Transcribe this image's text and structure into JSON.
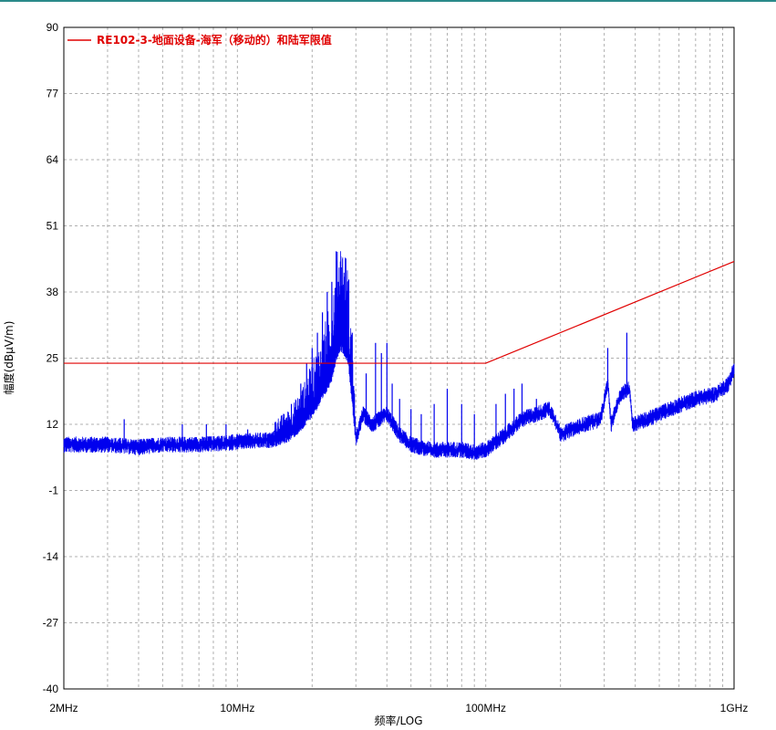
{
  "chart_data": {
    "type": "line",
    "xlabel": "频率/LOG",
    "ylabel": "幅度(dBμV/m)",
    "x_scale": "log",
    "xlim_hz": [
      2000000,
      1000000000
    ],
    "ylim": [
      -40,
      90
    ],
    "x_ticks": [
      {
        "label": "2MHz",
        "value": 2000000
      },
      {
        "label": "10MHz",
        "value": 10000000
      },
      {
        "label": "100MHz",
        "value": 100000000
      },
      {
        "label": "1GHz",
        "value": 1000000000
      }
    ],
    "y_ticks": [
      90,
      77,
      64,
      51,
      38,
      25,
      12,
      -1,
      -14,
      -27,
      -40
    ],
    "grid": true,
    "legend_position": "top-left",
    "colors": {
      "limit": "#e00000",
      "measurement": "#0000ee",
      "grid": "#b0b0b0"
    },
    "series": [
      {
        "name": "RE102-3-地面设备-海军（移动的）和陆军限值",
        "role": "limit",
        "points": [
          [
            2000000,
            24
          ],
          [
            100000000,
            24
          ],
          [
            1000000000,
            44
          ]
        ]
      },
      {
        "name": "",
        "role": "measurement",
        "points": [
          [
            2000000,
            8
          ],
          [
            3000000,
            8
          ],
          [
            4000000,
            7.5
          ],
          [
            5000000,
            8
          ],
          [
            7000000,
            8
          ],
          [
            10000000,
            8.5
          ],
          [
            14000000,
            9
          ],
          [
            16000000,
            10
          ],
          [
            18000000,
            12
          ],
          [
            20000000,
            15
          ],
          [
            22000000,
            18
          ],
          [
            24000000,
            22
          ],
          [
            25000000,
            26
          ],
          [
            26000000,
            28
          ],
          [
            27000000,
            27
          ],
          [
            28000000,
            25
          ],
          [
            30000000,
            9
          ],
          [
            32000000,
            14
          ],
          [
            35000000,
            12
          ],
          [
            40000000,
            14
          ],
          [
            45000000,
            10
          ],
          [
            50000000,
            8
          ],
          [
            60000000,
            7
          ],
          [
            70000000,
            7
          ],
          [
            80000000,
            7
          ],
          [
            90000000,
            6.5
          ],
          [
            100000000,
            7
          ],
          [
            120000000,
            10
          ],
          [
            140000000,
            13
          ],
          [
            160000000,
            14
          ],
          [
            180000000,
            15
          ],
          [
            190000000,
            13
          ],
          [
            200000000,
            10
          ],
          [
            250000000,
            12
          ],
          [
            290000000,
            13
          ],
          [
            310000000,
            20
          ],
          [
            320000000,
            12
          ],
          [
            350000000,
            18
          ],
          [
            380000000,
            19
          ],
          [
            390000000,
            12
          ],
          [
            450000000,
            13
          ],
          [
            550000000,
            15
          ],
          [
            700000000,
            17
          ],
          [
            850000000,
            18
          ],
          [
            950000000,
            20
          ],
          [
            1000000000,
            23
          ]
        ],
        "peaks": [
          [
            3500000,
            13
          ],
          [
            6000000,
            12
          ],
          [
            7500000,
            12
          ],
          [
            9000000,
            12
          ],
          [
            11000000,
            11
          ],
          [
            13000000,
            10
          ],
          [
            15000000,
            13
          ],
          [
            16500000,
            16
          ],
          [
            18000000,
            20
          ],
          [
            19000000,
            24
          ],
          [
            20000000,
            27
          ],
          [
            21000000,
            30
          ],
          [
            22000000,
            34
          ],
          [
            23000000,
            38
          ],
          [
            24000000,
            40
          ],
          [
            25000000,
            46
          ],
          [
            25500000,
            40
          ],
          [
            26000000,
            44
          ],
          [
            27000000,
            41
          ],
          [
            28000000,
            38
          ],
          [
            29000000,
            30
          ],
          [
            33000000,
            22
          ],
          [
            36000000,
            28
          ],
          [
            38000000,
            26
          ],
          [
            40000000,
            28
          ],
          [
            42000000,
            20
          ],
          [
            45000000,
            17
          ],
          [
            50000000,
            15
          ],
          [
            55000000,
            14
          ],
          [
            62000000,
            16
          ],
          [
            70000000,
            19
          ],
          [
            80000000,
            16
          ],
          [
            90000000,
            14
          ],
          [
            110000000,
            16
          ],
          [
            120000000,
            18
          ],
          [
            130000000,
            19
          ],
          [
            140000000,
            20
          ],
          [
            160000000,
            17
          ],
          [
            310000000,
            27
          ],
          [
            370000000,
            30
          ]
        ]
      }
    ]
  }
}
